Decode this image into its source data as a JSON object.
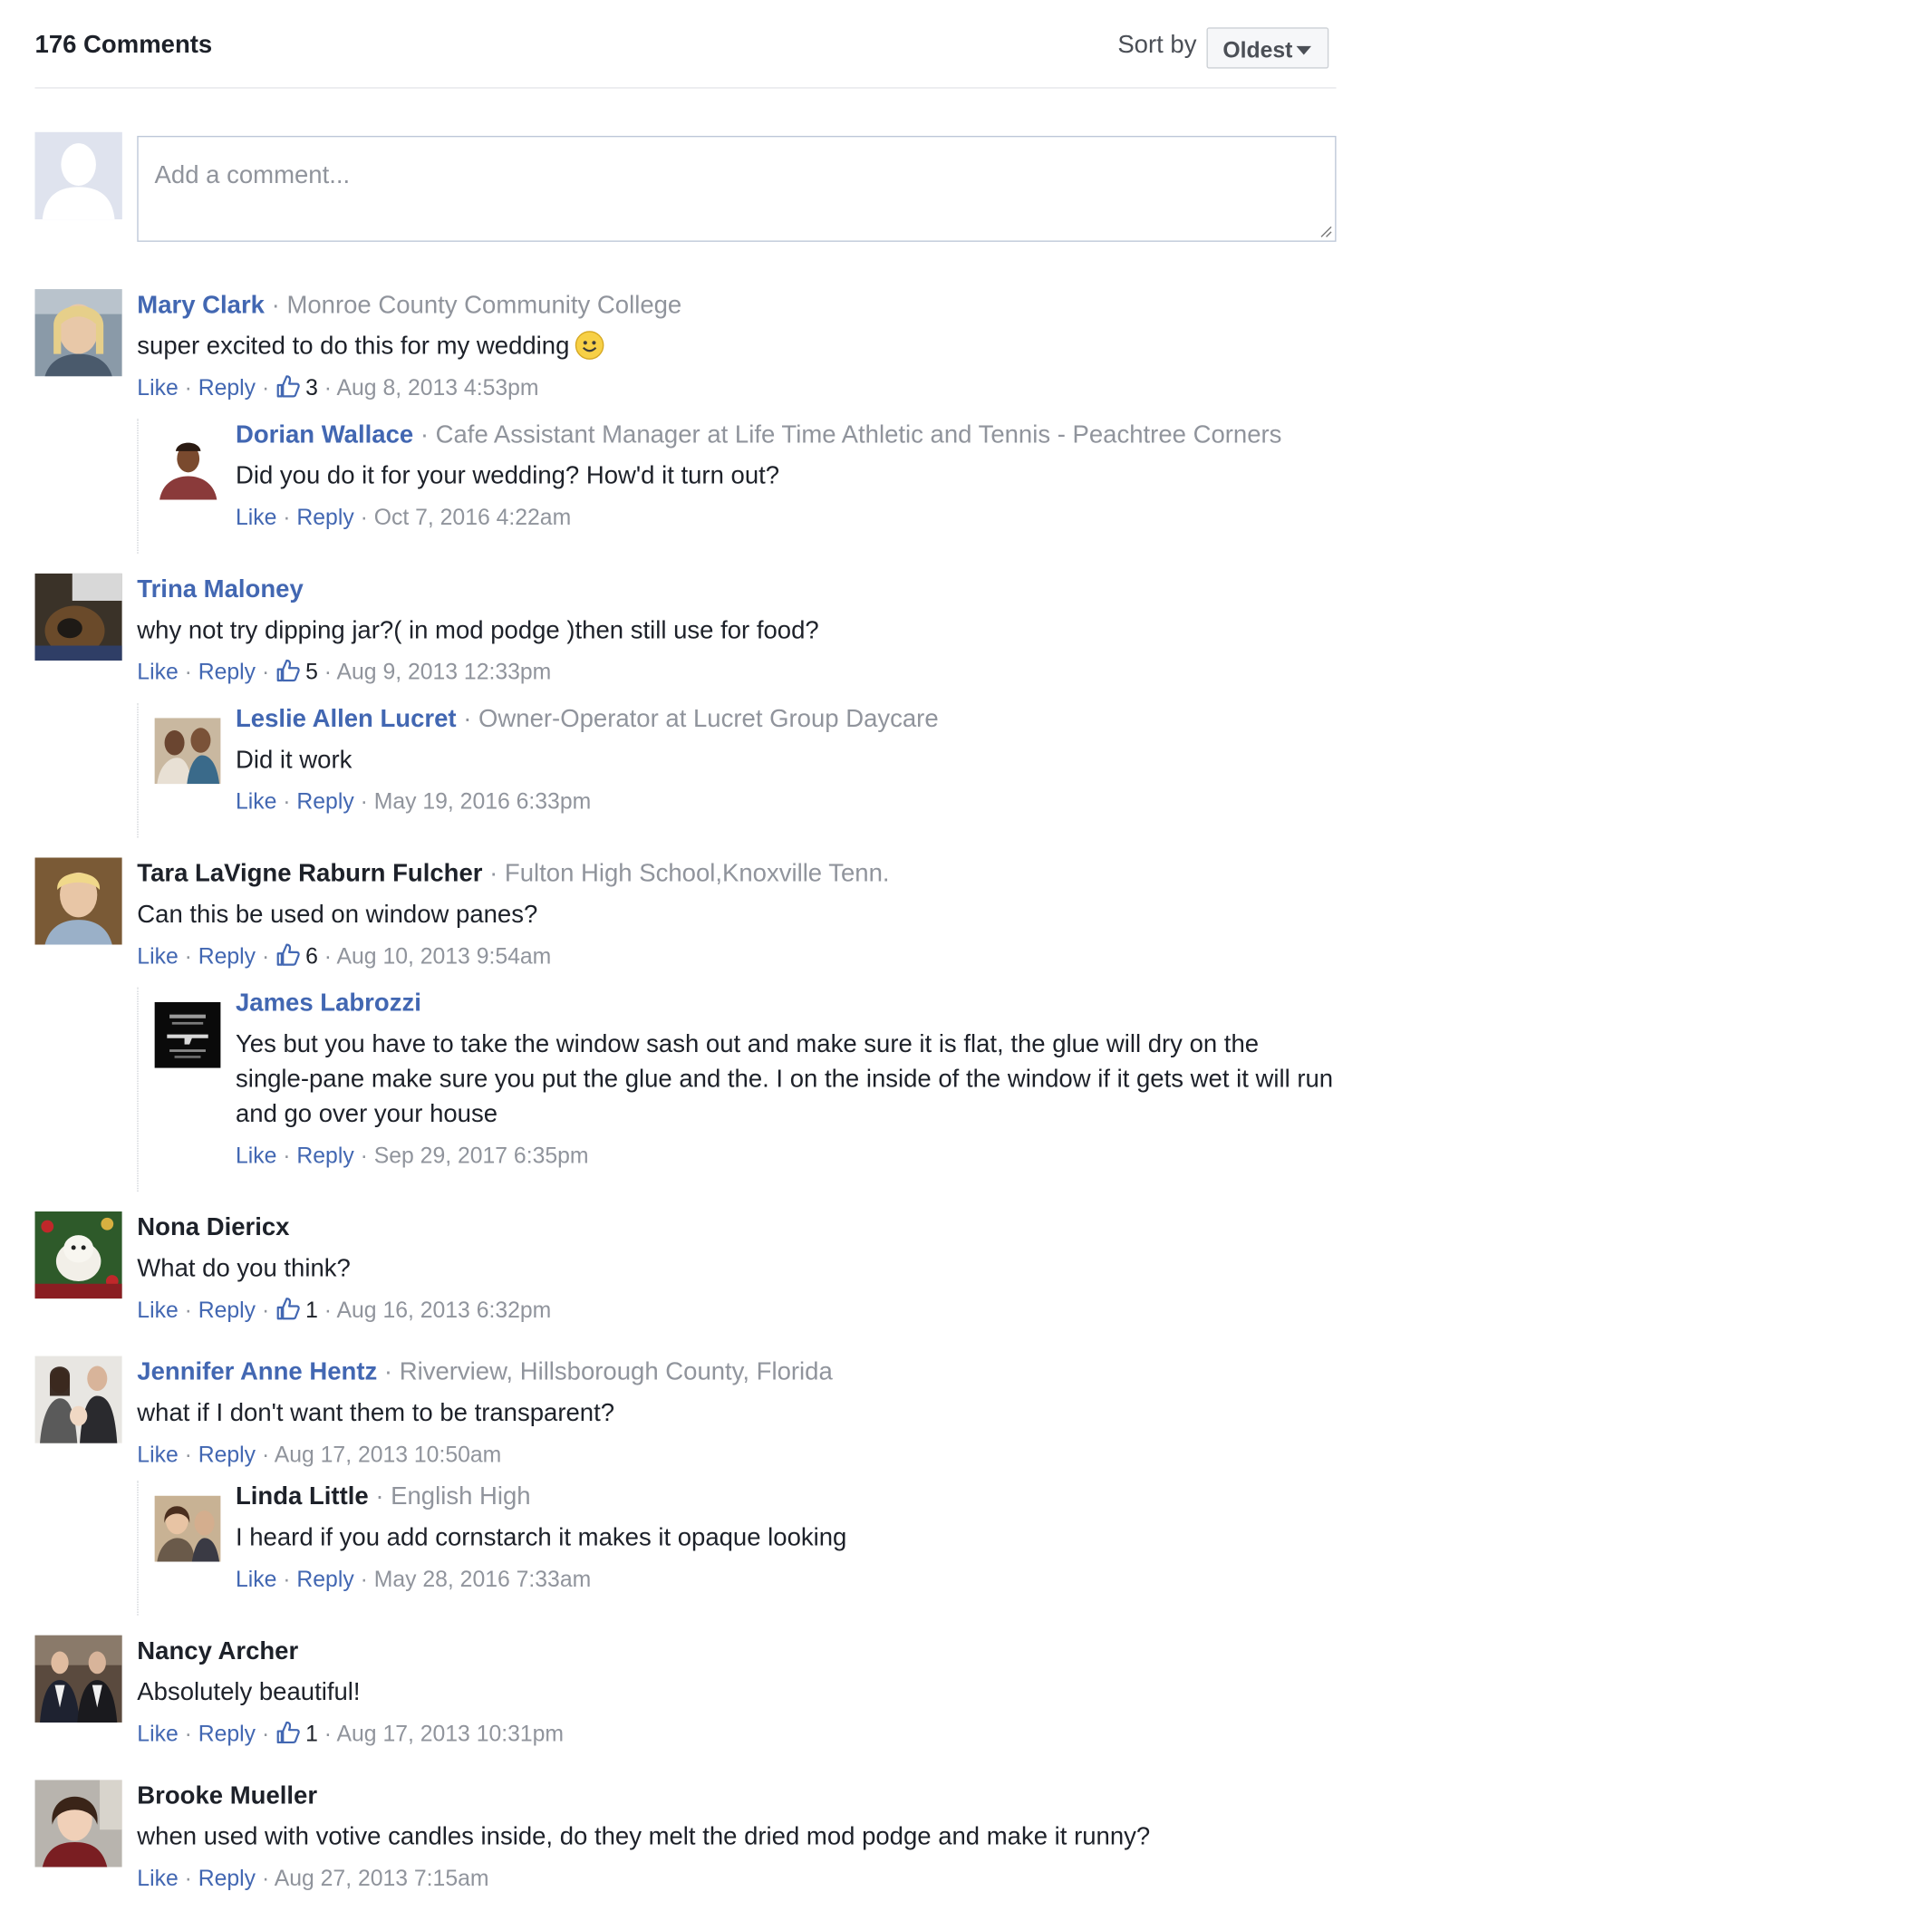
{
  "header": {
    "comment_count": "176 Comments",
    "sort_label": "Sort by",
    "sort_value": "Oldest"
  },
  "composer": {
    "placeholder": "Add a comment..."
  },
  "comments": [
    {
      "name": "Mary Clark",
      "meta": "Monroe County Community College",
      "text": "super excited to do this for my wedding",
      "like": "Like",
      "reply": "Reply",
      "likes": "3",
      "time": "Aug 8, 2013 4:53pm"
    },
    {
      "name": "Dorian Wallace",
      "meta": "Cafe Assistant Manager at Life Time Athletic and Tennis - Peachtree Corners",
      "text": "Did you do it for your wedding? How'd it turn out?",
      "like": "Like",
      "reply": "Reply",
      "time": "Oct 7, 2016 4:22am"
    },
    {
      "name": "Trina Maloney",
      "text": "why not try dipping jar?( in mod podge )then still use for food?",
      "like": "Like",
      "reply": "Reply",
      "likes": "5",
      "time": "Aug 9, 2013 12:33pm"
    },
    {
      "name": "Leslie Allen Lucret",
      "meta": "Owner-Operator at Lucret Group Daycare",
      "text": "Did it work",
      "like": "Like",
      "reply": "Reply",
      "time": "May 19, 2016 6:33pm"
    },
    {
      "name": "Tara LaVigne Raburn Fulcher",
      "meta": "Fulton High School,Knoxville Tenn.",
      "text": "Can this be used on window panes?",
      "like": "Like",
      "reply": "Reply",
      "likes": "6",
      "time": "Aug 10, 2013 9:54am"
    },
    {
      "name": "James Labrozzi",
      "text": "Yes but you have to take the window sash out and make sure it is flat, the glue will dry on the single-pane make sure you put the glue and the. I on the inside of the window if it gets wet it will run and go over your house",
      "like": "Like",
      "reply": "Reply",
      "time": "Sep 29, 2017 6:35pm"
    },
    {
      "name": "Nona Diericx",
      "text": "What do you think?",
      "like": "Like",
      "reply": "Reply",
      "likes": "1",
      "time": "Aug 16, 2013 6:32pm"
    },
    {
      "name": "Jennifer Anne Hentz",
      "meta": "Riverview, Hillsborough County, Florida",
      "text": "what if I don't want them to be transparent?",
      "like": "Like",
      "reply": "Reply",
      "time": "Aug 17, 2013 10:50am"
    },
    {
      "name": "Linda Little",
      "meta": "English High",
      "text": "I heard if you add cornstarch it makes it opaque looking",
      "like": "Like",
      "reply": "Reply",
      "time": "May 28, 2016 7:33am"
    },
    {
      "name": "Nancy Archer",
      "text": "Absolutely beautiful!",
      "like": "Like",
      "reply": "Reply",
      "likes": "1",
      "time": "Aug 17, 2013 10:31pm"
    },
    {
      "name": "Brooke Mueller",
      "text": "when used with votive candles inside, do they melt the dried mod podge and make it runny?",
      "like": "Like",
      "reply": "Reply",
      "time": "Aug 27, 2013 7:15am"
    }
  ]
}
